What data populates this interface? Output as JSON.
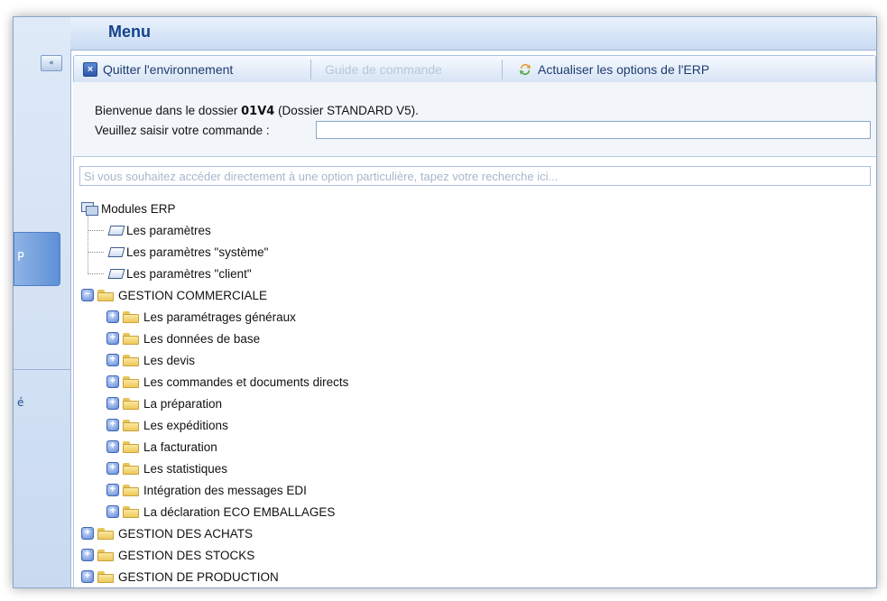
{
  "window": {
    "title": "Menu"
  },
  "sidebar": {
    "pin_label": "«",
    "tab1_label": "P",
    "tab2_label": "é"
  },
  "toolbar": {
    "quit_label": "Quitter l'environnement",
    "guide_label": "Guide de commande",
    "refresh_label": "Actualiser les options de l'ERP"
  },
  "welcome": {
    "prefix": "Bienvenue dans le dossier ",
    "dossier_code": "01V4",
    "suffix": " (Dossier STANDARD V5).",
    "command_label": "Veuillez saisir votre commande :",
    "command_value": ""
  },
  "search": {
    "placeholder": "Si vous souhaitez accéder directement à une option particulière, tapez votre recherche ici..."
  },
  "tree": {
    "root": "Modules ERP",
    "params": [
      "Les paramètres",
      "Les paramètres \"système\"",
      "Les paramètres \"client\""
    ],
    "gestion_commerciale": {
      "label": "GESTION COMMERCIALE",
      "children": [
        "Les paramétrages généraux",
        "Les données de base",
        "Les devis",
        "Les commandes et documents directs",
        "La préparation",
        "Les expéditions",
        "La facturation",
        "Les statistiques",
        "Intégration des messages EDI",
        "La déclaration ECO EMBALLAGES"
      ]
    },
    "others": [
      "GESTION DES ACHATS",
      "GESTION DES STOCKS",
      "GESTION DE PRODUCTION"
    ]
  },
  "icons": {
    "expander_collapsed": "plus-icon",
    "expander_expanded": "minus-icon",
    "folder": "folder-icon",
    "param": "param-icon",
    "module": "modules-icon"
  },
  "colors": {
    "title": "#15428b",
    "accent": "#5f86d6",
    "border": "#8aa6c8"
  }
}
